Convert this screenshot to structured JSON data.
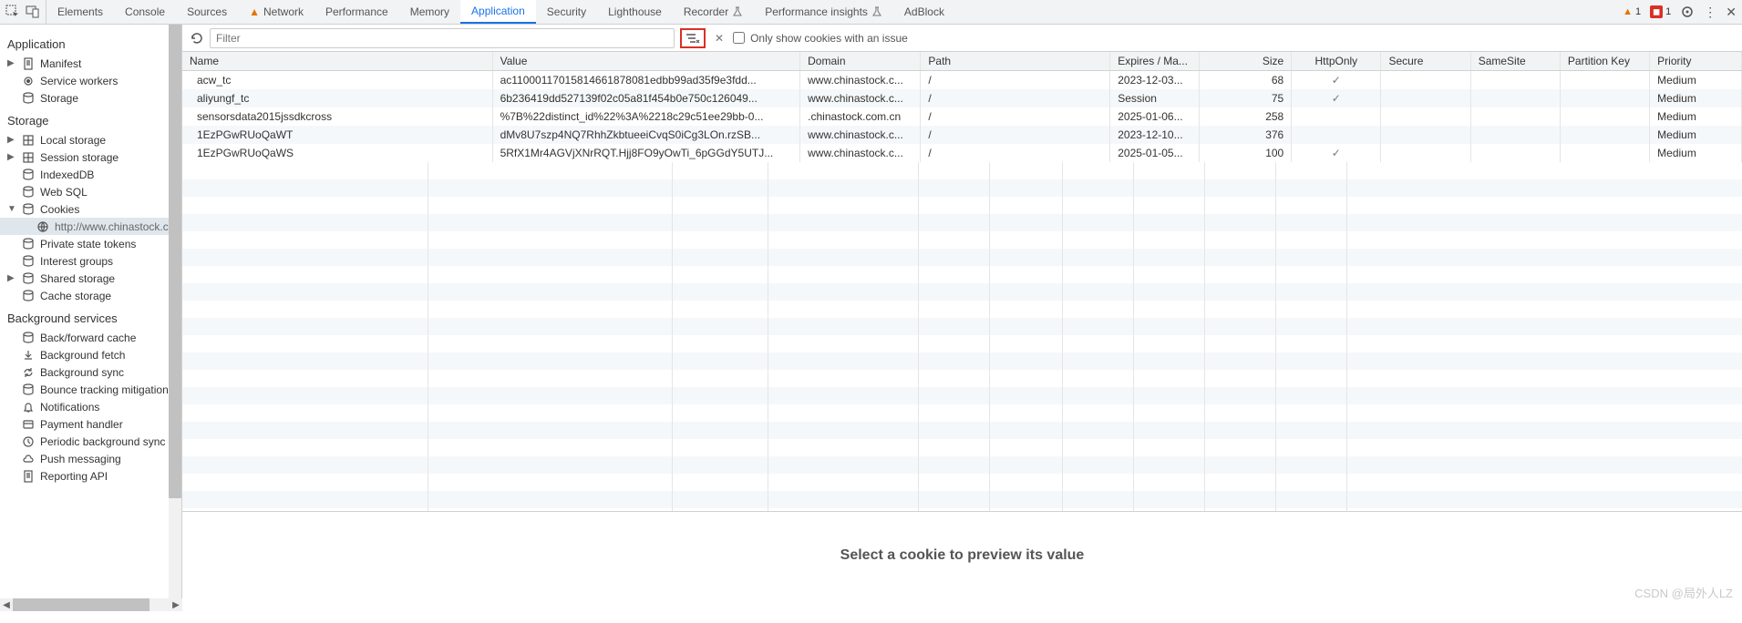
{
  "topTools": {
    "warnCount": "1",
    "errCount": "1"
  },
  "tabs": [
    {
      "label": "Elements",
      "warn": false
    },
    {
      "label": "Console",
      "warn": false
    },
    {
      "label": "Sources",
      "warn": false
    },
    {
      "label": "Network",
      "warn": true
    },
    {
      "label": "Performance",
      "warn": false
    },
    {
      "label": "Memory",
      "warn": false
    },
    {
      "label": "Application",
      "warn": false,
      "active": true
    },
    {
      "label": "Security",
      "warn": false
    },
    {
      "label": "Lighthouse",
      "warn": false
    },
    {
      "label": "Recorder",
      "warn": false,
      "flask": true
    },
    {
      "label": "Performance insights",
      "warn": false,
      "flask": true
    },
    {
      "label": "AdBlock",
      "warn": false
    }
  ],
  "sidebar": {
    "sections": [
      {
        "title": "Application",
        "items": [
          {
            "label": "Manifest",
            "caret": "▶",
            "icon": "doc"
          },
          {
            "label": "Service workers",
            "icon": "gear"
          },
          {
            "label": "Storage",
            "icon": "db"
          }
        ]
      },
      {
        "title": "Storage",
        "items": [
          {
            "label": "Local storage",
            "caret": "▶",
            "icon": "grid"
          },
          {
            "label": "Session storage",
            "caret": "▶",
            "icon": "grid"
          },
          {
            "label": "IndexedDB",
            "icon": "db"
          },
          {
            "label": "Web SQL",
            "icon": "db"
          },
          {
            "label": "Cookies",
            "caret": "▼",
            "icon": "db",
            "children": [
              {
                "label": "http://www.chinastock.com",
                "icon": "globe",
                "selected": true
              }
            ]
          },
          {
            "label": "Private state tokens",
            "icon": "db"
          },
          {
            "label": "Interest groups",
            "icon": "db"
          },
          {
            "label": "Shared storage",
            "caret": "▶",
            "icon": "db"
          },
          {
            "label": "Cache storage",
            "icon": "db"
          }
        ]
      },
      {
        "title": "Background services",
        "items": [
          {
            "label": "Back/forward cache",
            "icon": "db"
          },
          {
            "label": "Background fetch",
            "icon": "dl"
          },
          {
            "label": "Background sync",
            "icon": "sync"
          },
          {
            "label": "Bounce tracking mitigations",
            "icon": "db"
          },
          {
            "label": "Notifications",
            "icon": "bell"
          },
          {
            "label": "Payment handler",
            "icon": "card"
          },
          {
            "label": "Periodic background sync",
            "icon": "clock"
          },
          {
            "label": "Push messaging",
            "icon": "cloud"
          },
          {
            "label": "Reporting API",
            "icon": "doc"
          }
        ]
      }
    ]
  },
  "toolbar": {
    "filterPlaceholder": "Filter",
    "onlyIssuesLabel": "Only show cookies with an issue"
  },
  "columns": [
    "Name",
    "Value",
    "Domain",
    "Path",
    "Expires / Ma...",
    "Size",
    "HttpOnly",
    "Secure",
    "SameSite",
    "Partition Key",
    "Priority"
  ],
  "rows": [
    {
      "name": "acw_tc",
      "value": "ac11000117015814661878081edbb99ad35f9e3fdd...",
      "domain": "www.chinastock.c...",
      "path": "/",
      "expires": "2023-12-03...",
      "size": "68",
      "httponly": "✓",
      "secure": "",
      "samesite": "",
      "partkey": "",
      "priority": "Medium"
    },
    {
      "name": "aliyungf_tc",
      "value": "6b236419dd527139f02c05a81f454b0e750c126049...",
      "domain": "www.chinastock.c...",
      "path": "/",
      "expires": "Session",
      "size": "75",
      "httponly": "✓",
      "secure": "",
      "samesite": "",
      "partkey": "",
      "priority": "Medium"
    },
    {
      "name": "sensorsdata2015jssdkcross",
      "value": "%7B%22distinct_id%22%3A%2218c29c51ee29bb-0...",
      "domain": ".chinastock.com.cn",
      "path": "/",
      "expires": "2025-01-06...",
      "size": "258",
      "httponly": "",
      "secure": "",
      "samesite": "",
      "partkey": "",
      "priority": "Medium"
    },
    {
      "name": "1EzPGwRUoQaWT",
      "value": "dMv8U7szp4NQ7RhhZkbtueeiCvqS0iCg3LOn.rzSB...",
      "domain": "www.chinastock.c...",
      "path": "/",
      "expires": "2023-12-10...",
      "size": "376",
      "httponly": "",
      "secure": "",
      "samesite": "",
      "partkey": "",
      "priority": "Medium"
    },
    {
      "name": "1EzPGwRUoQaWS",
      "value": "5RfX1Mr4AGVjXNrRQT.Hjj8FO9yOwTi_6pGGdY5UTJ...",
      "domain": "www.chinastock.c...",
      "path": "/",
      "expires": "2025-01-05...",
      "size": "100",
      "httponly": "✓",
      "secure": "",
      "samesite": "",
      "partkey": "",
      "priority": "Medium"
    }
  ],
  "previewText": "Select a cookie to preview its value",
  "watermark": "CSDN @局外人LZ"
}
